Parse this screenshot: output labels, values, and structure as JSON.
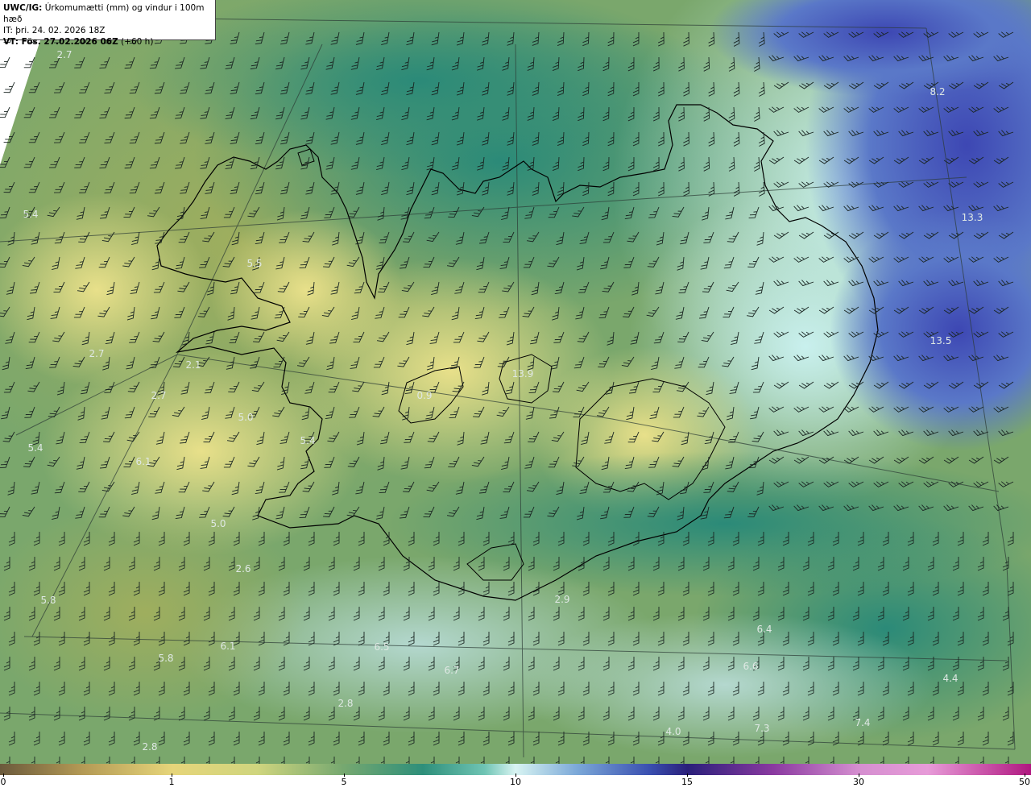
{
  "header": {
    "line1_prefix": "UWC/IG:",
    "line1_text": " Úrkomumætti (mm) og vindur i 100m hæð",
    "line2": "IT: þri. 24. 02. 2026 18Z",
    "line3_prefix": "VT: Fös. 27.02.2026 06Z",
    "line3_suffix": " (+60 h)"
  },
  "value_labels": [
    "2.7",
    "5.4",
    "5.5",
    "2.7",
    "2.1",
    "2.7",
    "5.0",
    "5.4",
    "5.4",
    "6.1",
    "5.0",
    "2.6",
    "5.8",
    "6.1",
    "5.8",
    "2.8",
    "2.8",
    "6.5",
    "6.7",
    "2.9",
    "6.4",
    "6.6",
    "4.0",
    "7.3",
    "7.4",
    "4.4",
    "8.2",
    "13.3",
    "13.5",
    "13.9",
    "0.9",
    "1.2"
  ],
  "colorbar": {
    "ticks": [
      "0",
      "1",
      "5",
      "10",
      "15",
      "30",
      "50"
    ]
  },
  "colors": {
    "low_precip": "#e6d57a",
    "mid_precip": "#2e8f7a",
    "high_precip": "#3a4fb0",
    "coastline": "#000000"
  }
}
